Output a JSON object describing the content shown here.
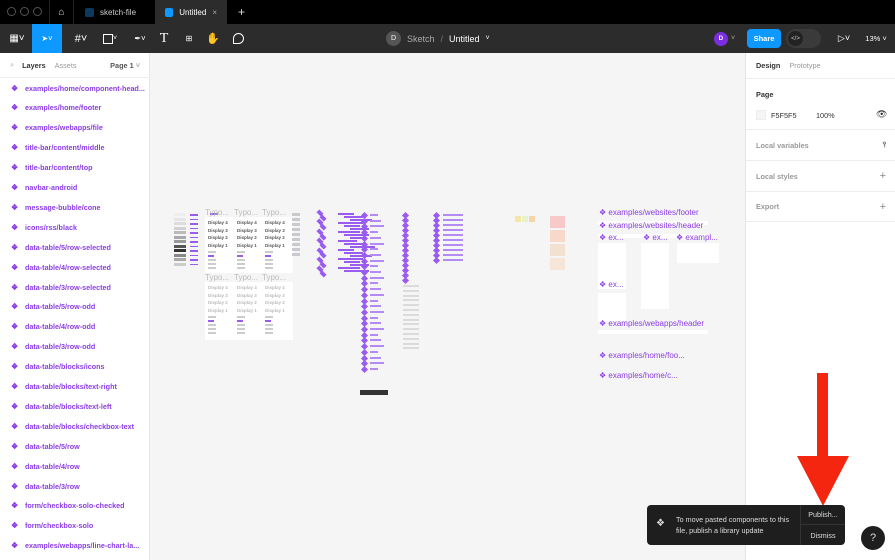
{
  "tabbar": {
    "tabs": [
      {
        "label": "sketch-file"
      },
      {
        "label": "Untitled"
      }
    ],
    "new_tab": "+",
    "close": "×"
  },
  "toolbar": {
    "breadcrumb_team": "Sketch",
    "breadcrumb_sep": "/",
    "file_name": "Untitled",
    "avatar": "D",
    "share": "Share",
    "zoom": "13%"
  },
  "left_panel": {
    "tabs": [
      "Layers",
      "Assets"
    ],
    "page": "Page 1",
    "layers": [
      "examples/home/component-head...",
      "examples/home/footer",
      "examples/webapps/file",
      "title-bar/content/middle",
      "title-bar/content/top",
      "navbar-android",
      "message-bubble/cone",
      "icons/rss/black",
      "data-table/5/row-selected",
      "data-table/4/row-selected",
      "data-table/3/row-selected",
      "data-table/5/row-odd",
      "data-table/4/row-odd",
      "data-table/3/row-odd",
      "data-table/blocks/icons",
      "data-table/blocks/text-right",
      "data-table/blocks/text-left",
      "data-table/blocks/checkbox-text",
      "data-table/5/row",
      "data-table/4/row",
      "data-table/3/row",
      "form/checkbox-solo-checked",
      "form/checkbox-solo",
      "examples/webapps/line-chart-la..."
    ]
  },
  "right_panel": {
    "tabs": [
      "Design",
      "Prototype"
    ],
    "page_title": "Page",
    "page_color": "F5F5F5",
    "opacity": "100%",
    "local_variables": "Local variables",
    "local_styles": "Local styles",
    "export": "Export"
  },
  "canvas": {
    "frame_labels": [
      "examples/websites/footer",
      "examples/websites/header",
      "ex...",
      "ex...",
      "exampl...",
      "ex...",
      "examples/webapps/header",
      "examples/home/foo...",
      "examples/home/c..."
    ],
    "typo_label": "Typo...",
    "typo_lines": [
      "Display 4",
      "Display 3",
      "Display 2",
      "Display 1"
    ]
  },
  "toast": {
    "message": "To move pasted components to this file, publish a library update",
    "publish": "Publish...",
    "dismiss": "Dismiss"
  },
  "help": "?",
  "colors": {
    "accent": "#0d99ff",
    "component": "#8b3de6",
    "arrow": "#f5260f"
  }
}
